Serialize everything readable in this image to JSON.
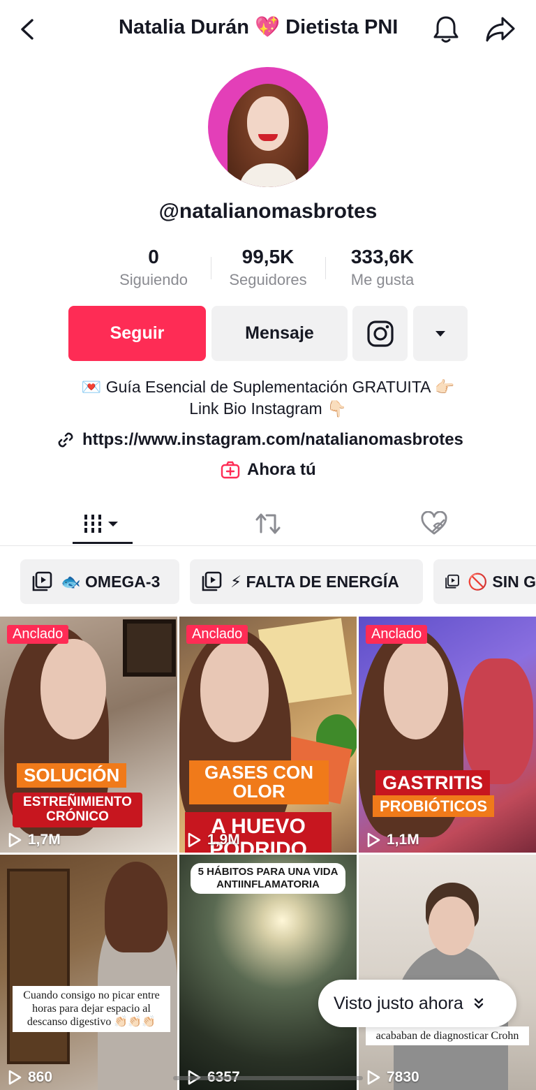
{
  "header": {
    "title": "Natalia Durán 💖 Dietista PNI"
  },
  "profile": {
    "username": "@natalianomasbrotes",
    "stats": [
      {
        "value": "0",
        "label": "Siguiendo"
      },
      {
        "value": "99,5K",
        "label": "Seguidores"
      },
      {
        "value": "333,6K",
        "label": "Me gusta"
      }
    ],
    "follow_label": "Seguir",
    "message_label": "Mensaje",
    "bio_line1": "💌 Guía Esencial de Suplementación GRATUITA 👉🏻",
    "bio_line2": "Link Bio Instagram 👇🏻",
    "link": "https://www.instagram.com/natalianomasbrotes",
    "ahora_label": "Ahora tú"
  },
  "playlists": [
    {
      "label": "🐟 OMEGA-3"
    },
    {
      "label": "⚡ FALTA DE ENERGÍA"
    },
    {
      "label": "🚫 SIN G"
    }
  ],
  "videos": [
    {
      "pinned": "Anclado",
      "views": "1,7M",
      "caption_top": "SOLUCIÓN",
      "caption_bottom": "ESTREÑIMIENTO CRÓNICO"
    },
    {
      "pinned": "Anclado",
      "views": "1,9M",
      "caption_top": "GASES CON OLOR",
      "caption_bottom": "A HUEVO PODRIDO"
    },
    {
      "pinned": "Anclado",
      "views": "1,1M",
      "caption_top": "GASTRITIS",
      "caption_bottom": "PROBIÓTICOS"
    },
    {
      "views": "860",
      "caption": "Cuando consigo no picar entre horas para dejar espacio al descanso digestivo 👏🏻👏🏻👏🏻"
    },
    {
      "views": "6357",
      "caption": "5 HÁBITOS PARA UNA VIDA ANTIINFLAMATORIA"
    },
    {
      "views": "7830",
      "caption": "acababan de diagnosticar Crohn"
    }
  ],
  "toast": {
    "label": "Visto justo ahora"
  },
  "colors": {
    "accent": "#fe2c55",
    "text": "#161823",
    "muted": "#8a8b91",
    "button_bg": "#f1f1f2"
  }
}
